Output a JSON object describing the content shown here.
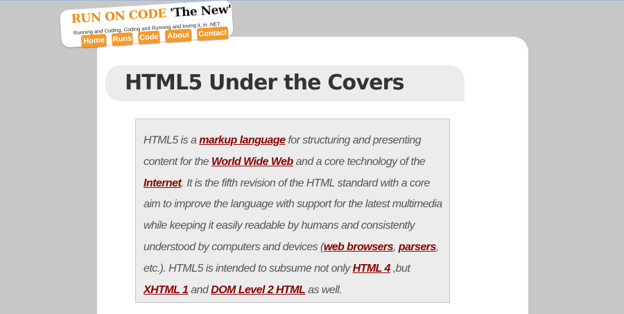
{
  "logo": {
    "title_part1": "RUN ON CODE",
    "title_part2": "'The New'",
    "tagline": "Running and Coding, Coding and Running and loving it, in .NET."
  },
  "nav": {
    "items": [
      {
        "label": "Home"
      },
      {
        "label": "Runs"
      },
      {
        "label": "Code"
      },
      {
        "label": "About"
      },
      {
        "label": "Contact"
      }
    ]
  },
  "article": {
    "title": "HTML5 Under the Covers",
    "segments": [
      {
        "t": "HTML5 is a "
      },
      {
        "t": "markup language",
        "link": true
      },
      {
        "t": " for structuring and presenting content for the "
      },
      {
        "t": "World Wide Web",
        "link": true
      },
      {
        "t": " and a core technology of the "
      },
      {
        "t": "Internet",
        "link": true
      },
      {
        "t": ". It is the fifth revision of the HTML standard with a core aim to improve the language with support for the latest multimedia while keeping it easily readable by humans and consistently understood by computers and devices ("
      },
      {
        "t": "web browsers",
        "link": true
      },
      {
        "t": ", "
      },
      {
        "t": "parsers",
        "link": true
      },
      {
        "t": ", etc.). HTML5 is intended to subsume not only "
      },
      {
        "t": "HTML 4",
        "link": true
      },
      {
        "t": " ,but "
      },
      {
        "t": "XHTML 1",
        "link": true
      },
      {
        "t": " and "
      },
      {
        "t": "DOM Level 2 HTML",
        "link": true
      },
      {
        "t": " as well."
      }
    ]
  },
  "colors": {
    "page_background": "#c8c8c8",
    "logo_accent": "#f28b14",
    "nav_button": "#f39a2b",
    "link": "#8b0000"
  }
}
